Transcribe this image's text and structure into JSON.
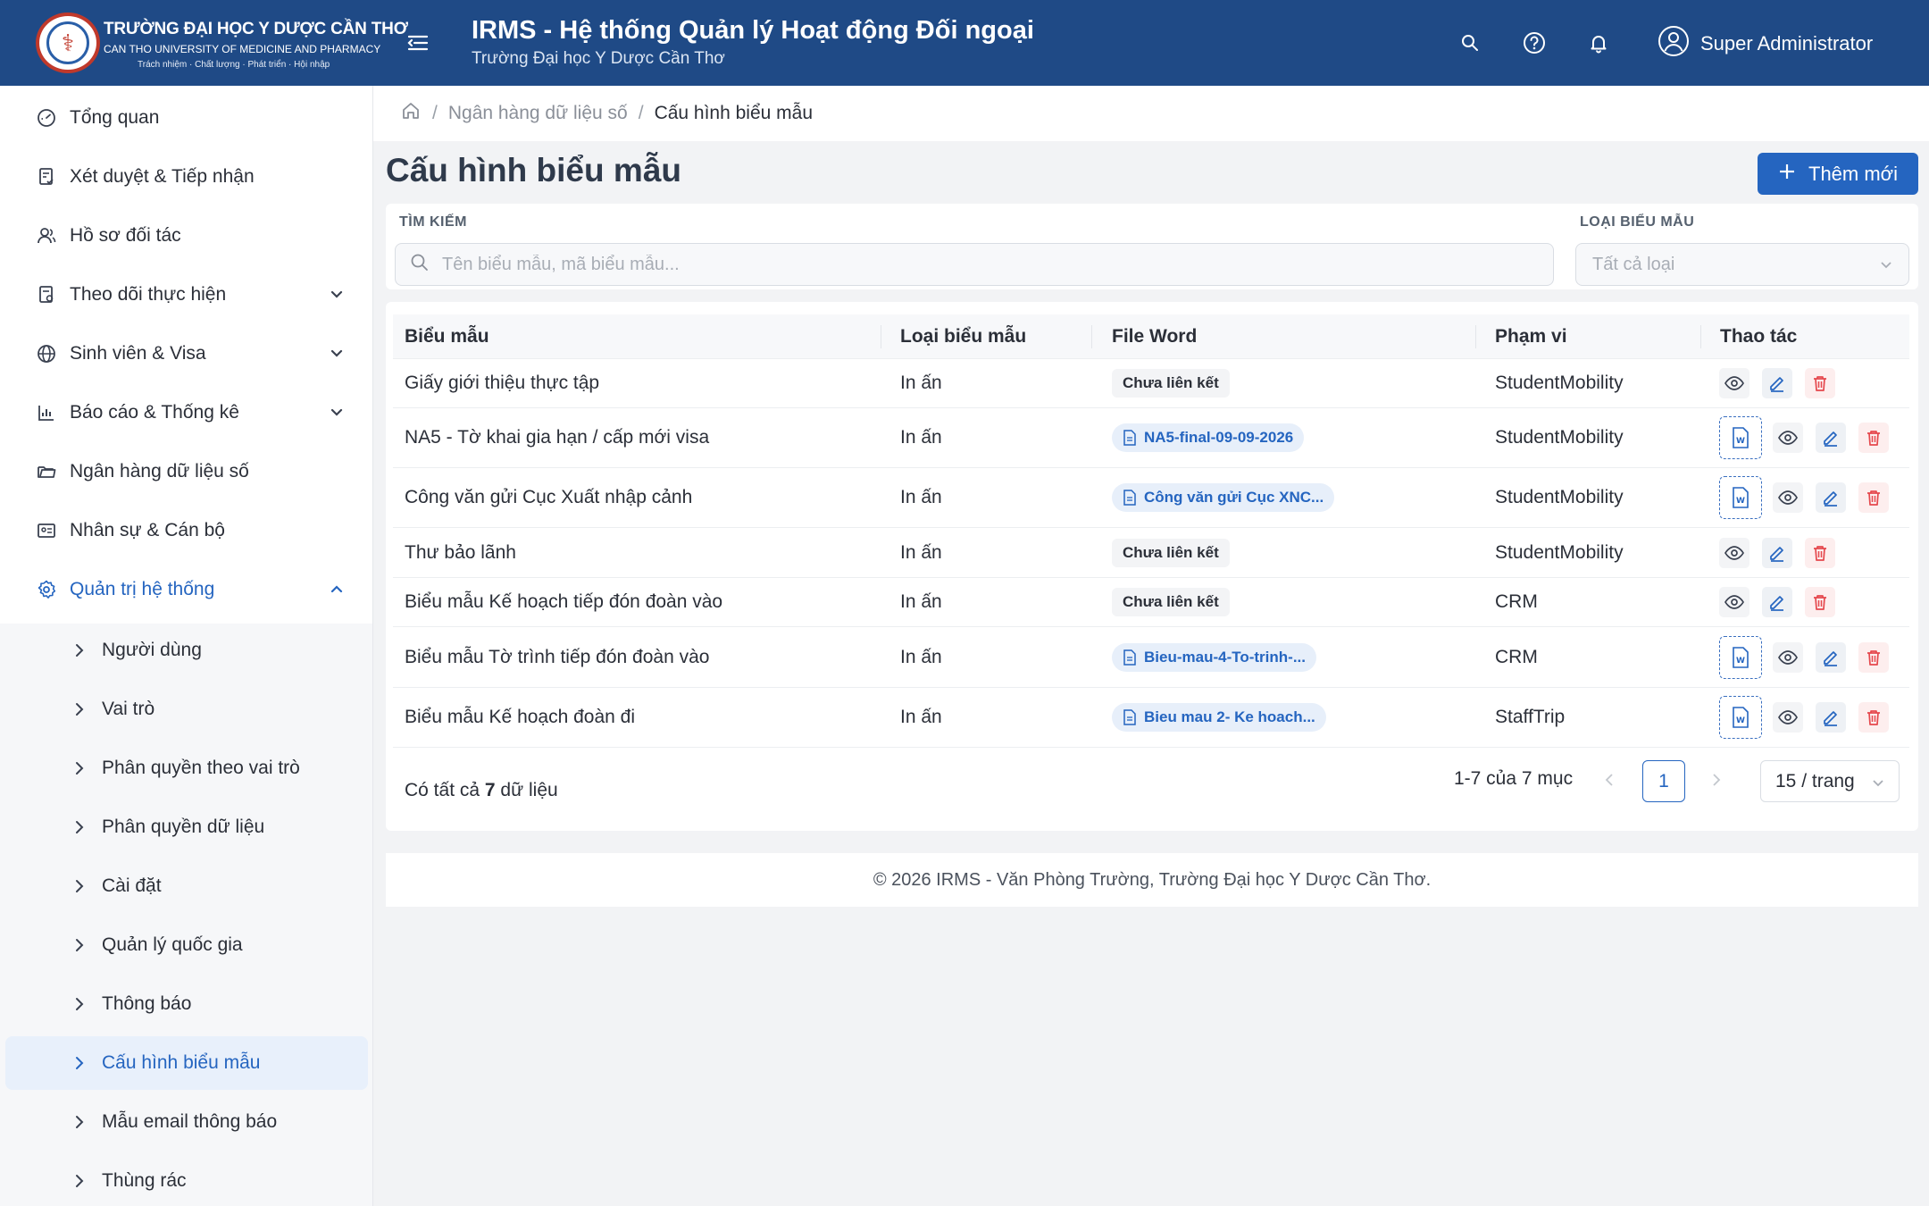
{
  "header": {
    "university_name": "TRƯỜNG ĐẠI HỌC Y DƯỢC CẦN THƠ",
    "university_en": "CAN THO UNIVERSITY OF MEDICINE AND PHARMACY",
    "motto": "Trách nhiệm · Chất lượng · Phát triển · Hội nhập",
    "app_title": "IRMS - Hệ thống Quản lý Hoạt động Đối ngoại",
    "app_subtitle": "Trường Đại học Y Dược Cần Thơ",
    "user_name": "Super Administrator",
    "icons": [
      "menu-icon",
      "search-icon",
      "help-icon",
      "bell-icon",
      "user-icon"
    ]
  },
  "sidebar": {
    "items": [
      {
        "label": "Tổng quan",
        "icon": "dashboard-icon"
      },
      {
        "label": "Xét duyệt & Tiếp nhận",
        "icon": "document-check-icon"
      },
      {
        "label": "Hồ sơ đối tác",
        "icon": "partner-icon"
      },
      {
        "label": "Theo dõi thực hiện",
        "icon": "tracking-icon",
        "expandable": true
      },
      {
        "label": "Sinh viên & Visa",
        "icon": "globe-icon",
        "expandable": true
      },
      {
        "label": "Báo cáo & Thống kê",
        "icon": "chart-icon",
        "expandable": true
      },
      {
        "label": "Ngân hàng dữ liệu số",
        "icon": "folder-icon"
      },
      {
        "label": "Nhân sự & Cán bộ",
        "icon": "id-card-icon"
      },
      {
        "label": "Quản trị hệ thống",
        "icon": "gear-icon",
        "expanded": true
      }
    ],
    "sub_items": [
      {
        "label": "Người dùng"
      },
      {
        "label": "Vai trò"
      },
      {
        "label": "Phân quyền theo vai trò"
      },
      {
        "label": "Phân quyền dữ liệu"
      },
      {
        "label": "Cài đặt"
      },
      {
        "label": "Quản lý quốc gia"
      },
      {
        "label": "Thông báo"
      },
      {
        "label": "Cấu hình biểu mẫu",
        "active": true
      },
      {
        "label": "Mẫu email thông báo"
      },
      {
        "label": "Thùng rác"
      }
    ]
  },
  "breadcrumb": {
    "parent": "Ngân hàng dữ liệu số",
    "current": "Cấu hình biểu mẫu",
    "separator": "/"
  },
  "page": {
    "title": "Cấu hình biểu mẫu",
    "add_button": "Thêm mới"
  },
  "filters": {
    "search_label": "TÌM KIẾM",
    "search_placeholder": "Tên biểu mẫu, mã biểu mẫu...",
    "search_value": "",
    "type_label": "LOẠI BIỂU MẪU",
    "type_value": "Tất cả loại"
  },
  "table": {
    "columns": [
      "Biểu mẫu",
      "Loại biểu mẫu",
      "File Word",
      "Phạm vi",
      "Thao tác"
    ],
    "rows": [
      {
        "name": "Giấy giới thiệu thực tập",
        "type": "In ấn",
        "file": "Chưa liên kết",
        "linked": false,
        "scope": "StudentMobility"
      },
      {
        "name": "NA5 - Tờ khai gia hạn / cấp mới visa",
        "type": "In ấn",
        "file": "NA5-final-09-09-2026",
        "linked": true,
        "scope": "StudentMobility"
      },
      {
        "name": "Công văn gửi Cục Xuất nhập cảnh",
        "type": "In ấn",
        "file": "Công văn gửi Cục XNC...",
        "linked": true,
        "scope": "StudentMobility"
      },
      {
        "name": "Thư bảo lãnh",
        "type": "In ấn",
        "file": "Chưa liên kết",
        "linked": false,
        "scope": "StudentMobility"
      },
      {
        "name": "Biểu mẫu Kế hoạch tiếp đón đoàn vào",
        "type": "In ấn",
        "file": "Chưa liên kết",
        "linked": false,
        "scope": "CRM"
      },
      {
        "name": "Biểu mẫu Tờ trình tiếp đón đoàn vào",
        "type": "In ấn",
        "file": "Bieu-mau-4-To-trinh-...",
        "linked": true,
        "scope": "CRM"
      },
      {
        "name": "Biểu mẫu Kế hoạch đoàn đi",
        "type": "In ấn",
        "file": "Bieu mau 2- Ke hoach...",
        "linked": true,
        "scope": "StaffTrip"
      }
    ],
    "total_prefix": "Có tất cả",
    "total_count": "7",
    "total_suffix": "dữ liệu"
  },
  "pagination": {
    "range": "1-7 của 7 mục",
    "current_page": "1",
    "per_page": "15 / trang"
  },
  "footer": {
    "text": "© 2026 IRMS - Văn Phòng Trường, Trường Đại học Y Dược Cần Thơ."
  },
  "colors": {
    "header_bg": "#1f4a86",
    "accent": "#2565c0",
    "danger": "#e5484d"
  }
}
